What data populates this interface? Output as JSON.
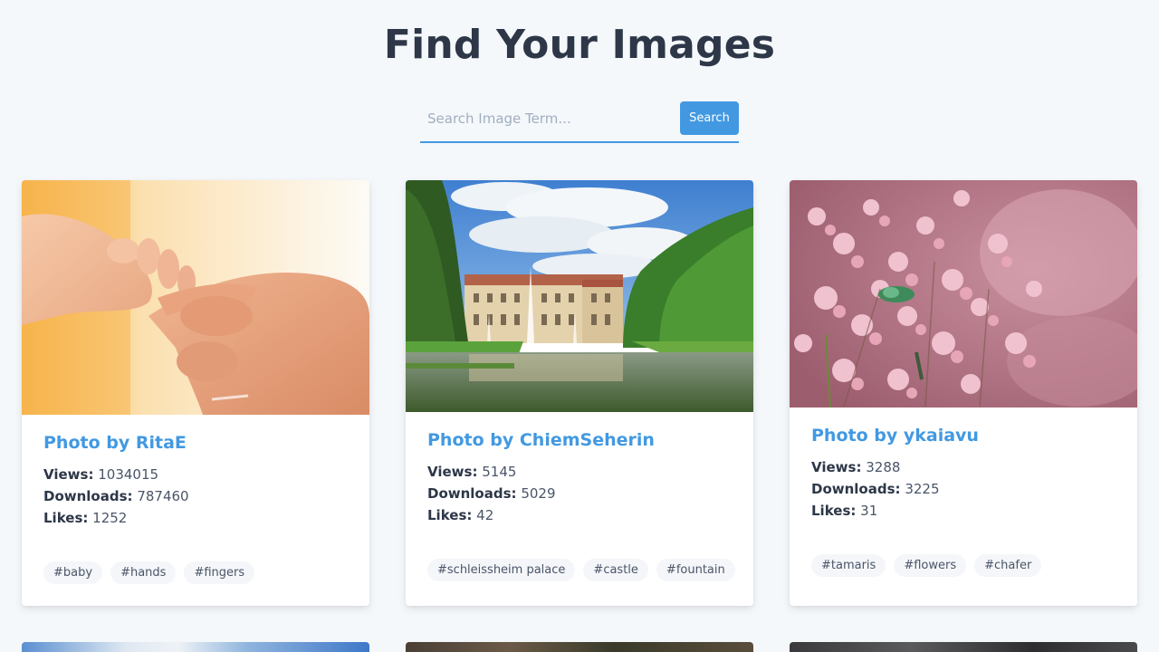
{
  "header": {
    "title": "Find Your Images"
  },
  "search": {
    "placeholder": "Search Image Term...",
    "value": "",
    "button_label": "Search"
  },
  "labels": {
    "views": "Views:",
    "downloads": "Downloads:",
    "likes": "Likes:"
  },
  "cards": [
    {
      "photographer": "Photo by RitaE",
      "image_subject": "baby hand holding adult finger",
      "views": "1034015",
      "downloads": "787460",
      "likes": "1252",
      "tags": [
        "#baby",
        "#hands",
        "#fingers"
      ]
    },
    {
      "photographer": "Photo by ChiemSeherin",
      "image_subject": "palace with fountain and canal",
      "views": "5145",
      "downloads": "5029",
      "likes": "42",
      "tags": [
        "#schleissheim palace",
        "#castle",
        "#fountain"
      ]
    },
    {
      "photographer": "Photo by ykaiavu",
      "image_subject": "pink tamaris flowers with green beetle",
      "views": "3288",
      "downloads": "3225",
      "likes": "31",
      "tags": [
        "#tamaris",
        "#flowers",
        "#chafer"
      ]
    }
  ],
  "colors": {
    "accent": "#4299e1",
    "heading": "#2d3748",
    "background": "#f5f8fb"
  }
}
